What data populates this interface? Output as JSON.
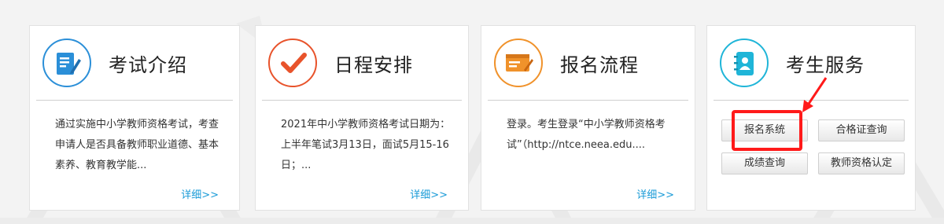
{
  "cards": [
    {
      "title": "考试介绍",
      "icon": "document-edit-icon",
      "accent": "#2b8fd8",
      "description": "通过实施中小学教师资格考试，考查申请人是否具备教师职业道德、基本素养、教育教学能...",
      "more": "详细>>"
    },
    {
      "title": "日程安排",
      "icon": "checkmark-icon",
      "accent": "#e8532b",
      "description": "2021年中小学教师资格考试日期为：上半年笔试3月13日，面试5月15-16日；...",
      "more": "详细>>"
    },
    {
      "title": "报名流程",
      "icon": "web-form-icon",
      "accent": "#f0922b",
      "description": "登录。考生登录“中小学教师资格考试”（http://ntce.neea.edu....",
      "more": "详细>>"
    }
  ],
  "service": {
    "title": "考生服务",
    "icon": "address-book-icon",
    "accent": "#1fb5d8",
    "buttons": [
      "报名系统",
      "合格证查询",
      "成绩查询",
      "教师资格认定"
    ]
  },
  "colors": {
    "link": "#1a9bd7",
    "highlight": "#ff1a1a"
  }
}
